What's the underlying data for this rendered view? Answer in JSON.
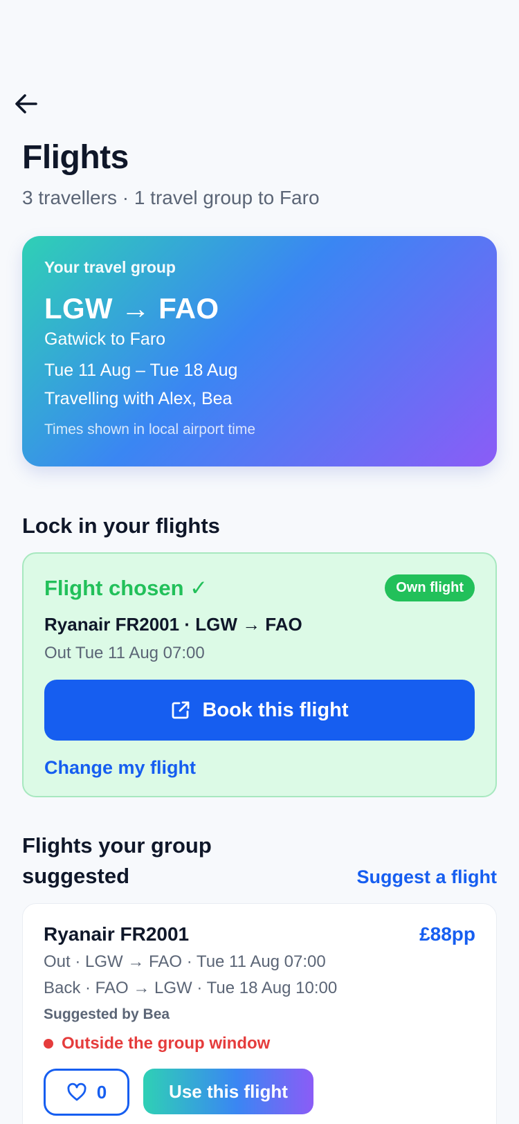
{
  "header": {
    "title": "Flights",
    "subtitle": "3 travellers · 1 travel group to Faro"
  },
  "group_card": {
    "label": "Your travel group",
    "route": "LGW → FAO",
    "route_sub": "Gatwick to Faro",
    "dates": "Tue 11 Aug – Tue 18 Aug",
    "with": "Travelling with Alex, Bea",
    "timezone_note": "Times shown in local airport time"
  },
  "lock_section": {
    "title": "Lock in your flights",
    "chosen_title": "Flight chosen ✓",
    "badge": "Own flight",
    "flight": "Ryanair FR2001 · LGW → FAO",
    "out": "Out Tue 11 Aug 07:00",
    "book_label": "Book this flight",
    "change_label": "Change my flight"
  },
  "suggested_section": {
    "title": "Flights your group suggested",
    "suggest_link": "Suggest a flight",
    "items": [
      {
        "flight": "Ryanair FR2001",
        "price": "£88pp",
        "out": "Out · LGW → FAO · Tue 11 Aug 07:00",
        "back": "Back · FAO → LGW · Tue 18 Aug 10:00",
        "suggested_by": "Suggested by Bea",
        "warning": "Outside the group window",
        "likes": "0",
        "use_label": "Use this flight"
      }
    ]
  },
  "colors": {
    "accent": "#165ef0",
    "success": "#22c05a",
    "danger": "#e53c3c"
  },
  "icons": [
    "arrow-left-icon",
    "external-link-icon",
    "heart-icon"
  ]
}
